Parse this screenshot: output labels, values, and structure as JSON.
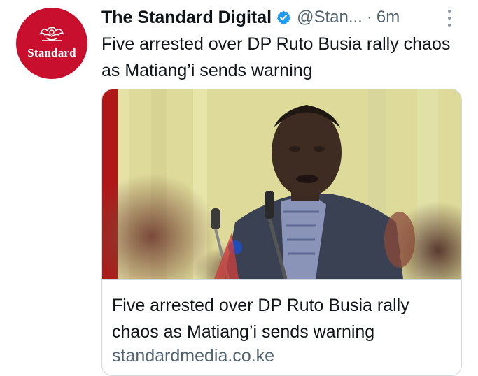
{
  "account": {
    "avatar_text": "Standard",
    "name": "The Standard Digital",
    "handle": "@Stan...",
    "separator": "·",
    "time": "6m"
  },
  "tweet": {
    "text": "Five arrested over DP Ruto Busia rally chaos as Matiang’i sends warning"
  },
  "card": {
    "title": "Five arrested over DP Ruto Busia rally chaos as Matiang’i sends warning",
    "domain": "standardmedia.co.ke"
  },
  "icons": {
    "verified": "verified-badge-icon",
    "more": "more-options-icon"
  },
  "colors": {
    "avatar_bg": "#c8102e",
    "verified": "#1d9bf0",
    "secondary_text": "#536471"
  }
}
